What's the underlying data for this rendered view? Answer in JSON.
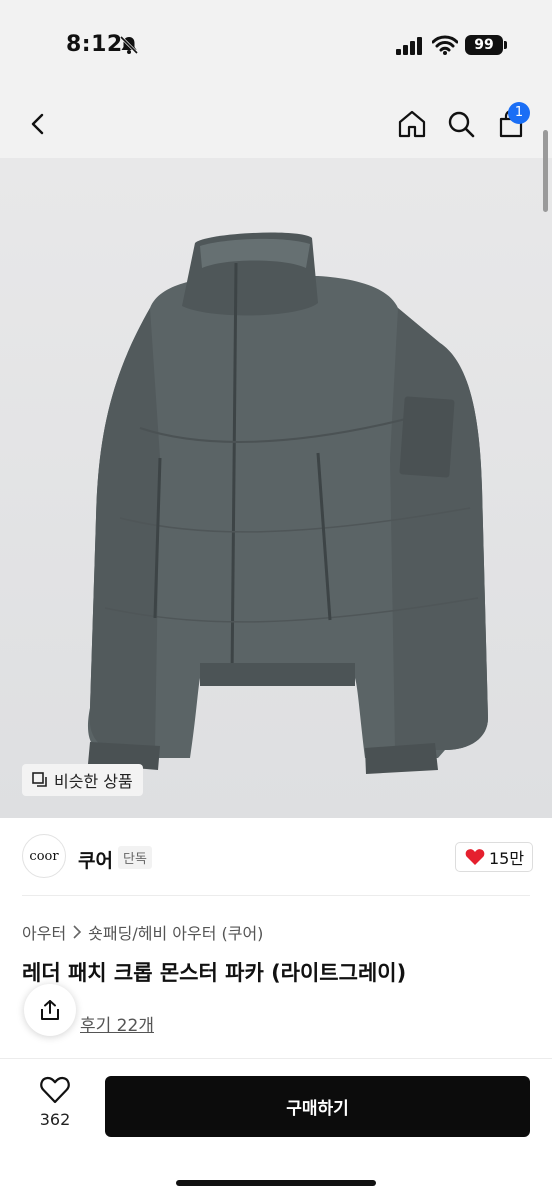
{
  "status_bar": {
    "time": "8:12",
    "battery": "99",
    "icons": [
      "bell-slash-icon",
      "signal-icon",
      "wifi-icon",
      "battery-icon"
    ]
  },
  "nav": {
    "icons": [
      "back-icon",
      "home-icon",
      "search-icon",
      "cart-icon"
    ],
    "cart_count": "1"
  },
  "product": {
    "similar_label": "비슷한 상품",
    "brand_logo_text": "coor",
    "brand_name": "쿠어",
    "brand_tag": "단독",
    "like_chip_count": "15만",
    "breadcrumb": [
      "아우터",
      "숏패딩/헤비 아우터 (쿠어)"
    ],
    "title": "레더 패치 크롭 몬스터 파카 (라이트그레이)",
    "review_link": "후기 22개"
  },
  "bottom_bar": {
    "like_count": "362",
    "buy_label": "구매하기"
  },
  "colors": {
    "accent_blue": "#1a6ef5",
    "heart_red": "#e5202e",
    "jacket": "#5b6466"
  }
}
